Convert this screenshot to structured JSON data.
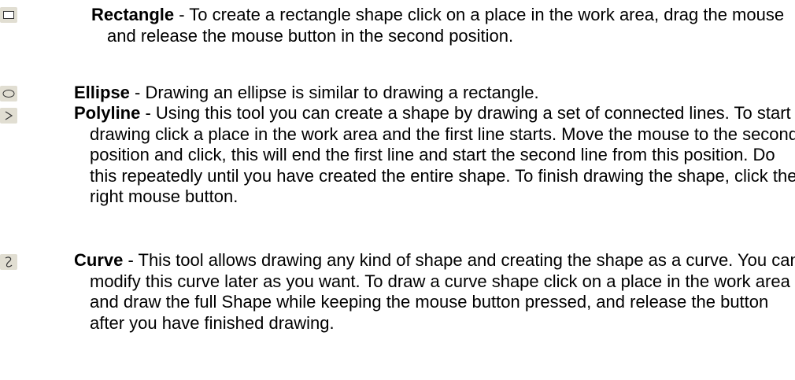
{
  "tools": [
    {
      "icon": "rectangle-icon",
      "name": "Rectangle",
      "text": " - To create a rectangle shape click on a place in the work area, drag the mouse and release the mouse button in the second position."
    },
    {
      "icon": "ellipse-icon",
      "name": "Ellipse",
      "text": " - Drawing an ellipse is similar to drawing a rectangle."
    },
    {
      "icon": "polyline-icon",
      "name": "Polyline",
      "text": " - Using this tool you can create a shape by drawing a set of connected lines. To start drawing click a place in the work area and the first line starts. Move the mouse to the second position and click, this will end the first line and start the second line from this position. Do this repeatedly until you have created the entire shape. To finish drawing the shape, click the right mouse button."
    },
    {
      "icon": "curve-icon",
      "name": "Curve",
      "text": " - This tool allows drawing any kind of shape and creating the shape as a curve. You can modify this curve later as you want. To draw a curve shape click on a place in the work area and draw the full Shape while keeping the mouse button pressed, and release the button after you have finished drawing."
    }
  ]
}
